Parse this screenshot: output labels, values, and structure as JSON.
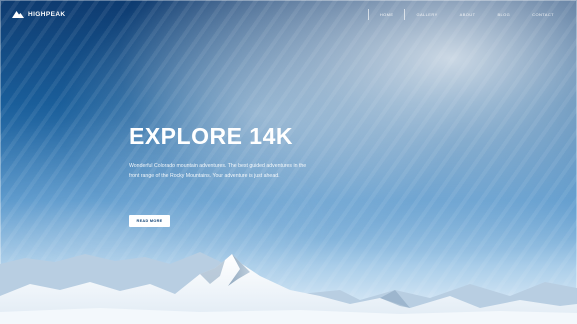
{
  "brand": {
    "name": "HIGHPEAK",
    "logo_icon": "mountain-logo-icon"
  },
  "nav": {
    "items": [
      {
        "label": "HOME",
        "active": true
      },
      {
        "label": "GALLERY",
        "active": false
      },
      {
        "label": "ABOUT",
        "active": false
      },
      {
        "label": "BLOG",
        "active": false
      },
      {
        "label": "CONTACT",
        "active": false
      }
    ]
  },
  "hero": {
    "title": "EXPLORE 14K",
    "description": "Wonderful Colorado mountain adventures. The best guided adventures in the front range of the Rocky Mountains. Your adventure is just ahead.",
    "cta_label": "READ MORE"
  },
  "colors": {
    "sky_dark": "#0e3b70",
    "sky_light": "#a9cde9",
    "snow": "#f3f8fc",
    "button_text": "#0c3f73"
  }
}
